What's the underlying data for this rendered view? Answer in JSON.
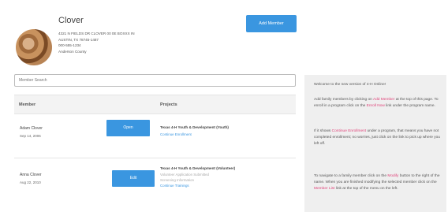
{
  "family": {
    "name": "Clover",
    "address_line1": "4321 N FIELDS DR CLOVER 00 0E BOXXX IN",
    "address_line2": "AUSTIN, TX 78745-1487",
    "phone": "000-555-1234",
    "county": "Anderson County",
    "add_member_label": "Add Member"
  },
  "search": {
    "placeholder": "Member Search"
  },
  "table": {
    "header_member": "Member",
    "header_projects": "Projects",
    "rows": [
      {
        "name": "Adam Clover",
        "dob": "Sep 14, 2006",
        "button_label": "Open",
        "project_title": "Texas 4-H Youth & Development (Youth)",
        "project_lines": [
          {
            "text": "Continue Enrollment",
            "style": "link"
          }
        ]
      },
      {
        "name": "Anna Clover",
        "dob": "Aug 22, 2010",
        "button_label": "Edit",
        "project_title": "Texas 4-H Youth & Development (Volunteer)",
        "project_lines": [
          {
            "text": "Volunteer Application Submitted",
            "style": "muted"
          },
          {
            "text": "Screening Information",
            "style": "muted"
          },
          {
            "text": "Continue Trainings",
            "style": "link"
          }
        ]
      }
    ]
  },
  "info_panel": {
    "p1": "Welcome to the new version of 4-H Online!",
    "p2_a": "Add family members by clicking on",
    "p2_hl": "Add Member",
    "p2_b": "at the top of this page. To enroll in a program click on the",
    "p2_hl2": "Enroll Now",
    "p2_c": "link under the program name.",
    "p3_a": "If it shows",
    "p3_hl": "Continue Enrollment",
    "p3_b": "under a program, that means you have not completed enrollment; no worries, just click on the link to pick up where you left off.",
    "p4_a": "To navigate to a family member click on the",
    "p4_hl": "Modify",
    "p4_b": "button to the right of the name. When you are finished modifying the selected member click on the",
    "p4_hl2": "Member List",
    "p4_c": "link at the top of the menu on the left."
  },
  "colors": {
    "accent": "#3a96e0",
    "highlight": "#e0457b",
    "panel_bg": "#efefef"
  }
}
